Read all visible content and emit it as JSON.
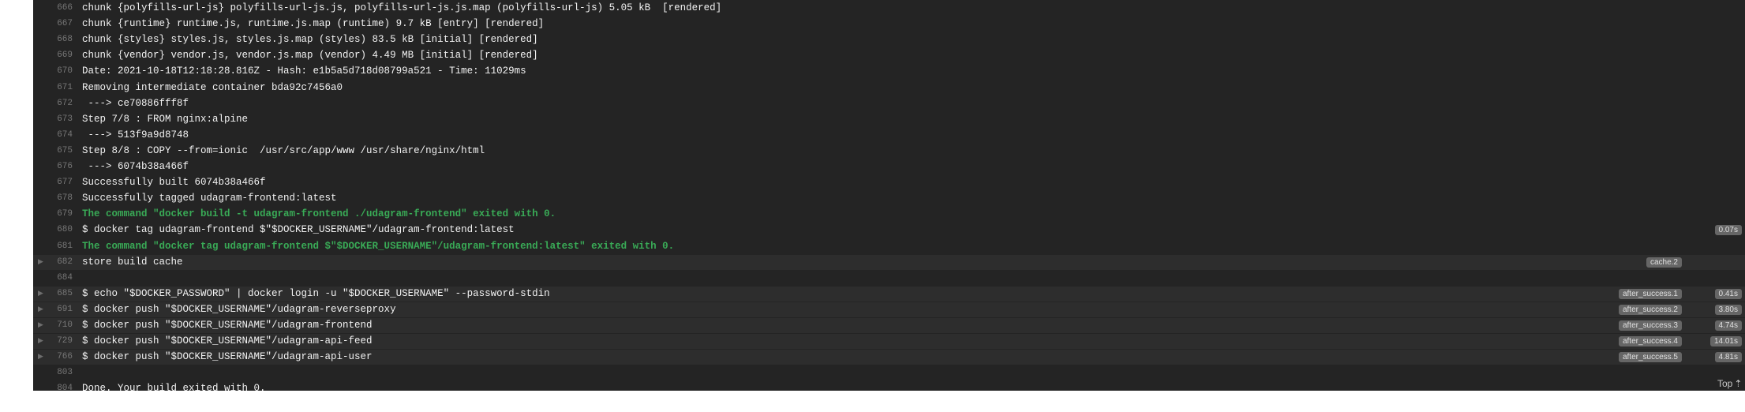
{
  "log_lines": [
    {
      "num": "666",
      "text": "chunk {polyfills-url-js} polyfills-url-js.js, polyfills-url-js.js.map (polyfills-url-js) 5.05 kB  [rendered]"
    },
    {
      "num": "667",
      "text": "chunk {runtime} runtime.js, runtime.js.map (runtime) 9.7 kB [entry] [rendered]"
    },
    {
      "num": "668",
      "text": "chunk {styles} styles.js, styles.js.map (styles) 83.5 kB [initial] [rendered]"
    },
    {
      "num": "669",
      "text": "chunk {vendor} vendor.js, vendor.js.map (vendor) 4.49 MB [initial] [rendered]"
    },
    {
      "num": "670",
      "text": "Date: 2021-10-18T12:18:28.816Z - Hash: e1b5a5d718d08799a521 - Time: 11029ms"
    },
    {
      "num": "671",
      "text": "Removing intermediate container bda92c7456a0"
    },
    {
      "num": "672",
      "text": " ---> ce70886fff8f"
    },
    {
      "num": "673",
      "text": "Step 7/8 : FROM nginx:alpine"
    },
    {
      "num": "674",
      "text": " ---> 513f9a9d8748"
    },
    {
      "num": "675",
      "text": "Step 8/8 : COPY --from=ionic  /usr/src/app/www /usr/share/nginx/html"
    },
    {
      "num": "676",
      "text": " ---> 6074b38a466f"
    },
    {
      "num": "677",
      "text": "Successfully built 6074b38a466f"
    },
    {
      "num": "678",
      "text": "Successfully tagged udagram-frontend:latest"
    },
    {
      "num": "679",
      "text": "The command \"docker build -t udagram-frontend ./udagram-frontend\" exited with 0.",
      "style": "green"
    },
    {
      "num": "680",
      "text": "$ docker tag udagram-frontend $\"$DOCKER_USERNAME\"/udagram-frontend:latest",
      "time": "0.07s"
    },
    {
      "num": "681",
      "text": "The command \"docker tag udagram-frontend $\"$DOCKER_USERNAME\"/udagram-frontend:latest\" exited with 0.",
      "style": "green"
    },
    {
      "num": "682",
      "text": "store build cache",
      "fold": true,
      "stage": "cache.2"
    },
    {
      "num": "684",
      "text": ""
    },
    {
      "num": "685",
      "text": "$ echo \"$DOCKER_PASSWORD\" | docker login -u \"$DOCKER_USERNAME\" --password-stdin",
      "fold": true,
      "stage": "after_success.1",
      "time": "0.41s"
    },
    {
      "num": "691",
      "text": "$ docker push \"$DOCKER_USERNAME\"/udagram-reverseproxy",
      "fold": true,
      "stage": "after_success.2",
      "time": "3.80s"
    },
    {
      "num": "710",
      "text": "$ docker push \"$DOCKER_USERNAME\"/udagram-frontend",
      "fold": true,
      "stage": "after_success.3",
      "time": "4.74s"
    },
    {
      "num": "729",
      "text": "$ docker push \"$DOCKER_USERNAME\"/udagram-api-feed",
      "fold": true,
      "stage": "after_success.4",
      "time": "14.01s"
    },
    {
      "num": "766",
      "text": "$ docker push \"$DOCKER_USERNAME\"/udagram-api-user",
      "fold": true,
      "stage": "after_success.5",
      "time": "4.81s"
    },
    {
      "num": "803",
      "text": ""
    },
    {
      "num": "804",
      "text": "Done. Your build exited with 0."
    }
  ],
  "top_link": {
    "label": "Top",
    "icon": "arrow-up-icon",
    "glyph": "⇡"
  },
  "fold_icon": {
    "name": "triangle-right-icon",
    "glyph": "▶"
  },
  "colors": {
    "background": "#242424",
    "text": "#f2f2f2",
    "success": "#39aa56",
    "badge": "#666666"
  }
}
